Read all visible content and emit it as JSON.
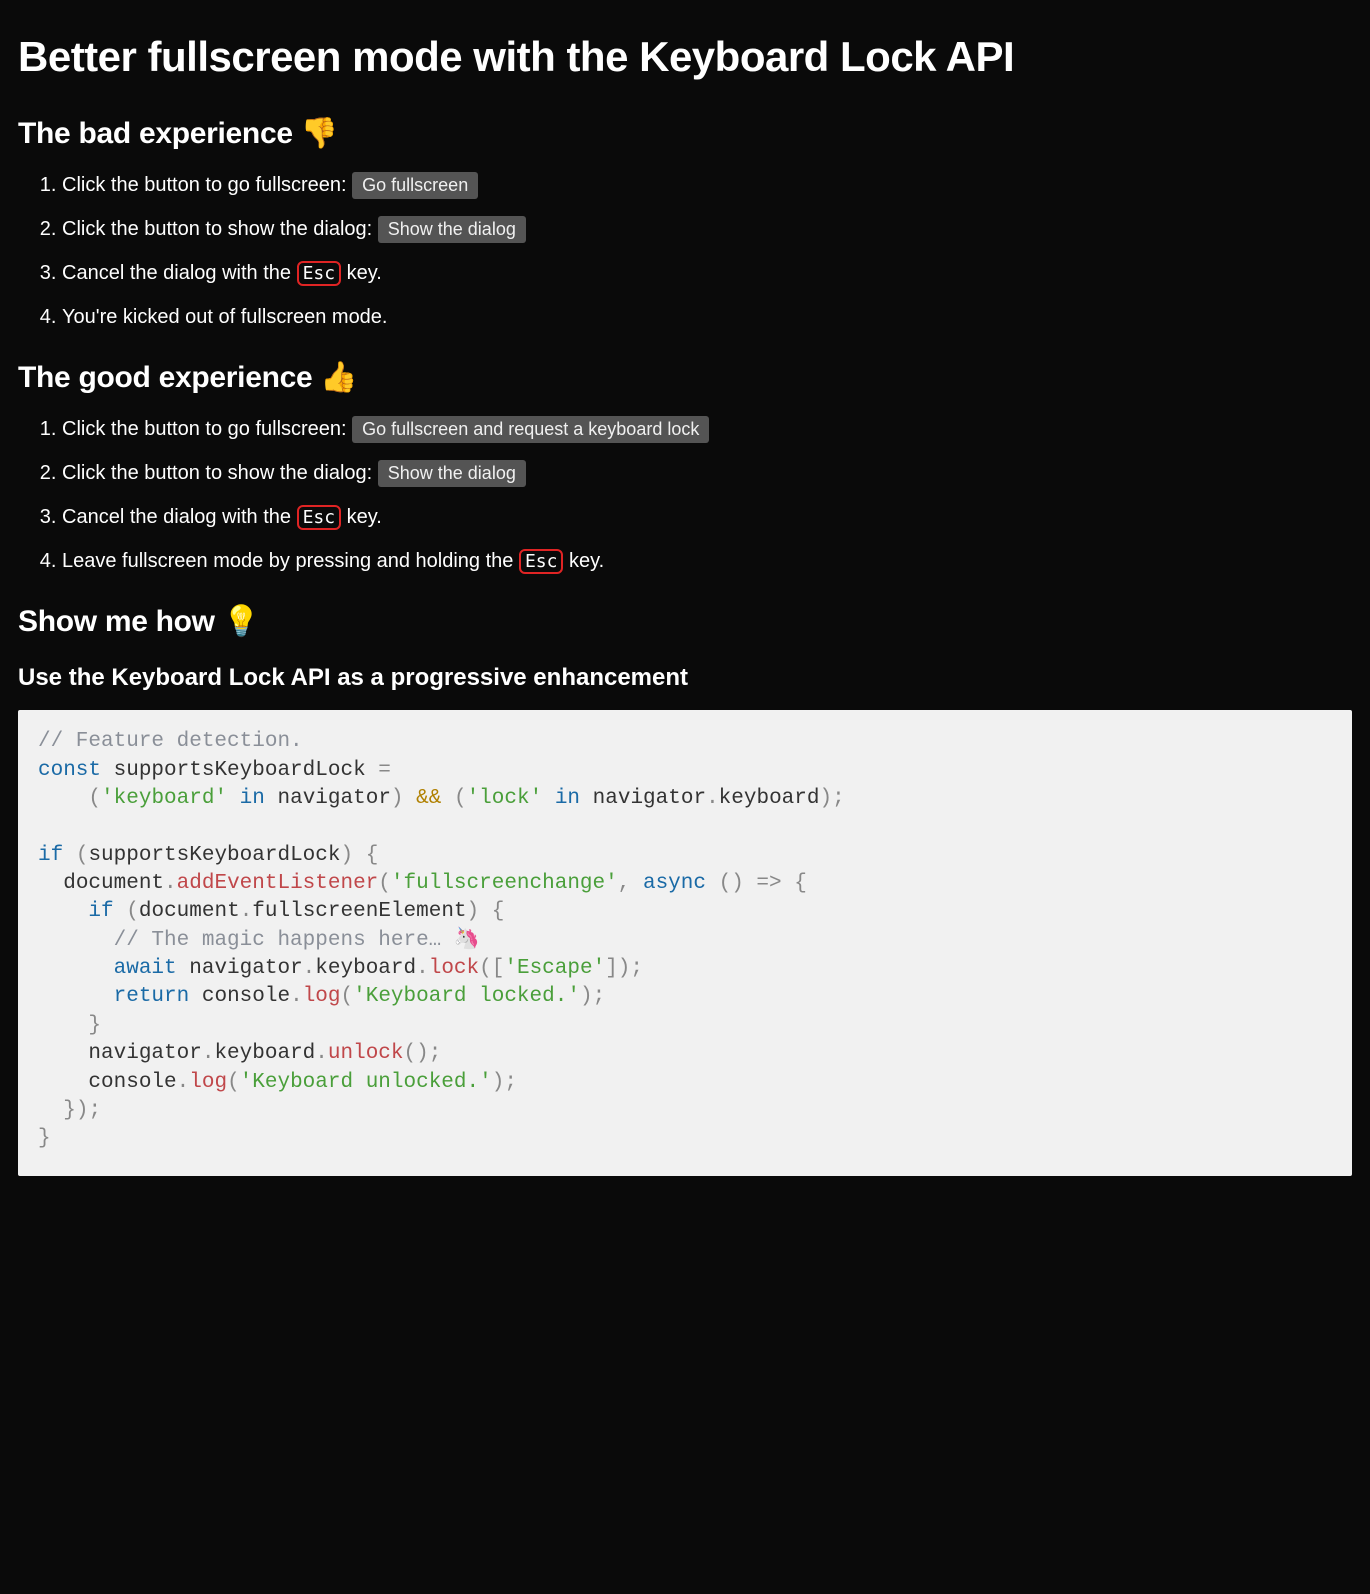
{
  "title": "Better fullscreen mode with the Keyboard Lock API",
  "bad": {
    "heading": "The bad experience 👎",
    "step1_text": "Click the button to go fullscreen: ",
    "step1_button": "Go fullscreen",
    "step2_text": "Click the button to show the dialog: ",
    "step2_button": "Show the dialog",
    "step3_pre": "Cancel the dialog with the ",
    "step3_key": "Esc",
    "step3_post": " key.",
    "step4": "You're kicked out of fullscreen mode."
  },
  "good": {
    "heading": "The good experience 👍",
    "step1_text": "Click the button to go fullscreen: ",
    "step1_button": "Go fullscreen and request a keyboard lock",
    "step2_text": "Click the button to show the dialog: ",
    "step2_button": "Show the dialog",
    "step3_pre": "Cancel the dialog with the ",
    "step3_key": "Esc",
    "step3_post": " key.",
    "step4_pre": "Leave fullscreen mode by pressing and holding the ",
    "step4_key": "Esc",
    "step4_post": " key."
  },
  "how": {
    "heading": "Show me how 💡",
    "subheading": "Use the Keyboard Lock API as a progressive enhancement"
  },
  "code": {
    "c1": "// Feature detection.",
    "kw_const": "const",
    "id_supports": "supportsKeyboardLock",
    "eq": "=",
    "lp": "(",
    "rp": ")",
    "str_keyboard": "'keyboard'",
    "kw_in": "in",
    "id_navigator": "navigator",
    "amp": "&&",
    "str_lock": "'lock'",
    "dot": ".",
    "id_keyboard": "keyboard",
    "semi": ";",
    "kw_if": "if",
    "lb": "{",
    "rb": "}",
    "id_document": "document",
    "fn_addEventListener": "addEventListener",
    "str_fschange": "'fullscreenchange'",
    "comma": ",",
    "kw_async": "async",
    "arrow": "=>",
    "id_fsElement": "fullscreenElement",
    "c_magic": "// The magic happens here… 🦄",
    "kw_await": "await",
    "fn_lock": "lock",
    "lbr": "[",
    "rbr": "]",
    "str_escape": "'Escape'",
    "kw_return": "return",
    "id_console": "console",
    "fn_log": "log",
    "str_locked": "'Keyboard locked.'",
    "fn_unlock": "unlock",
    "str_unlocked": "'Keyboard unlocked.'"
  }
}
